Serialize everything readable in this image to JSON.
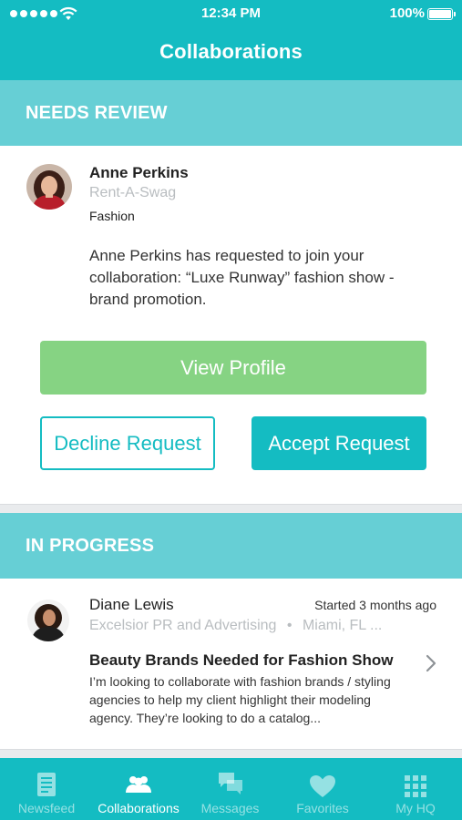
{
  "status_bar": {
    "time": "12:34 PM",
    "battery": "100%"
  },
  "header": {
    "title": "Collaborations"
  },
  "needs_review": {
    "section_title": "NEEDS REVIEW",
    "request": {
      "name": "Anne Perkins",
      "company": "Rent-A-Swag",
      "category": "Fashion",
      "message": "Anne Perkins has requested to join your collaboration: “Luxe Runway” fashion show - brand promotion.",
      "view_profile_label": "View Profile",
      "decline_label": "Decline Request",
      "accept_label": "Accept Request"
    }
  },
  "in_progress": {
    "section_title": "IN PROGRESS",
    "item": {
      "name": "Diane Lewis",
      "started": "Started 3 months ago",
      "company": "Excelsior PR and Advertising",
      "separator": "•",
      "location": "Miami, FL ...",
      "title": "Beauty Brands Needed for Fashion Show",
      "description": "I’m looking to collaborate with fashion brands / styling agencies to help my client highlight their modeling agency. They’re looking to do a catalog..."
    }
  },
  "tabbar": {
    "tabs": [
      {
        "label": "Newsfeed",
        "icon": "newsfeed-icon"
      },
      {
        "label": "Collaborations",
        "icon": "collaborations-icon",
        "active": true
      },
      {
        "label": "Messages",
        "icon": "messages-icon"
      },
      {
        "label": "Favorites",
        "icon": "heart-icon"
      },
      {
        "label": "My HQ",
        "icon": "grid-icon"
      }
    ]
  },
  "colors": {
    "teal": "#14bcc2",
    "section_teal": "#66cfd5",
    "green": "#86d383",
    "gray_text": "#b9bdc0"
  }
}
